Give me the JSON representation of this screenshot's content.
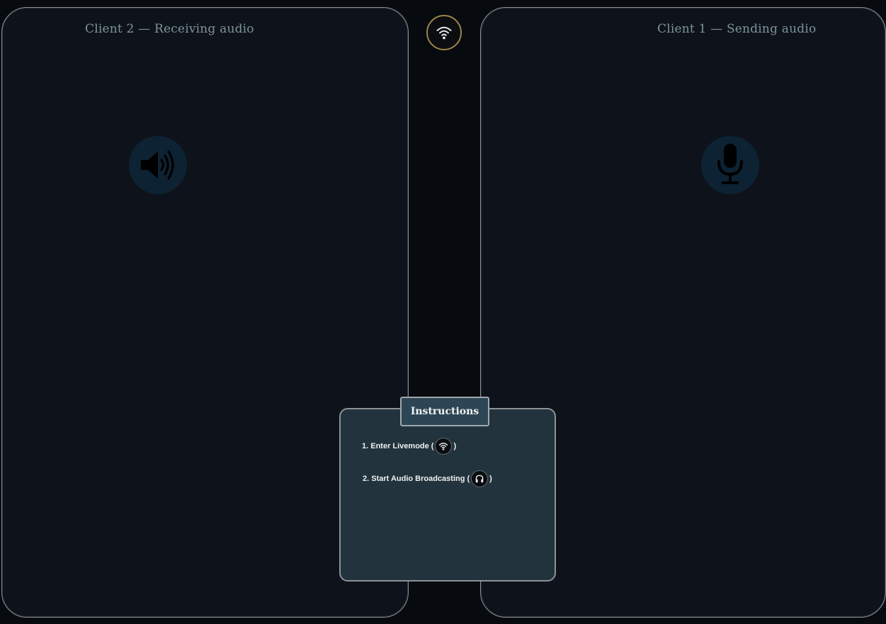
{
  "panels": {
    "left": {
      "title": "Client 2 — Receiving audio",
      "icon": "speaker-icon"
    },
    "right": {
      "title": "Client 1 — Sending audio",
      "icon": "microphone-icon"
    }
  },
  "live_button": {
    "icon": "wifi-icon"
  },
  "instructions": {
    "tab_label": "Instructions",
    "step1_text": "1. Enter Livemode (",
    "step1_close": ")",
    "step1_icon": "wifi-icon",
    "step2_text": "2. Start Audio Broadcasting (",
    "step2_close": ")",
    "step2_icon": "headphones-icon"
  },
  "colors": {
    "background": "#070b10",
    "panel": "#0e131b",
    "panel_border": "#8a8f96",
    "title_text": "#7d9498",
    "icon_circle": "#0d2232",
    "live_button_ring": "#9c8448",
    "instructions_bg": "#22333d",
    "instructions_tab_bg": "#2c4655"
  }
}
